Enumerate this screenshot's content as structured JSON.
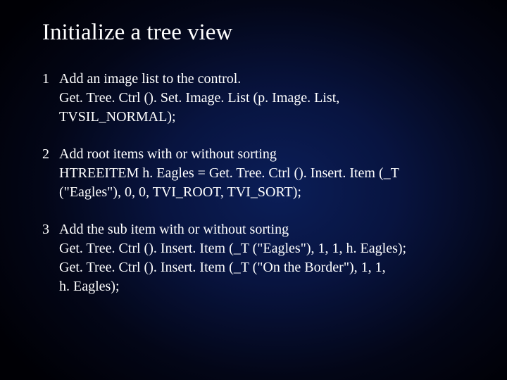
{
  "title": "Initialize a tree view",
  "items": [
    {
      "num": "1",
      "lead": "Add an image list to the control.",
      "lines": [
        "Get. Tree. Ctrl (). Set. Image. List (p. Image. List,",
        "TVSIL_NORMAL);"
      ]
    },
    {
      "num": "2",
      "lead": "Add root items with or without sorting",
      "lines": [
        "HTREEITEM h. Eagles = Get. Tree. Ctrl (). Insert. Item (_T",
        "(\"Eagles\"), 0, 0, TVI_ROOT, TVI_SORT);"
      ]
    },
    {
      "num": "3",
      "lead": "Add the sub item with or without sorting",
      "lines": [
        "Get. Tree. Ctrl (). Insert. Item (_T (\"Eagles\"), 1, 1, h. Eagles);",
        "Get. Tree. Ctrl (). Insert. Item (_T (\"On the Border\"), 1, 1,",
        "h. Eagles);"
      ]
    }
  ]
}
